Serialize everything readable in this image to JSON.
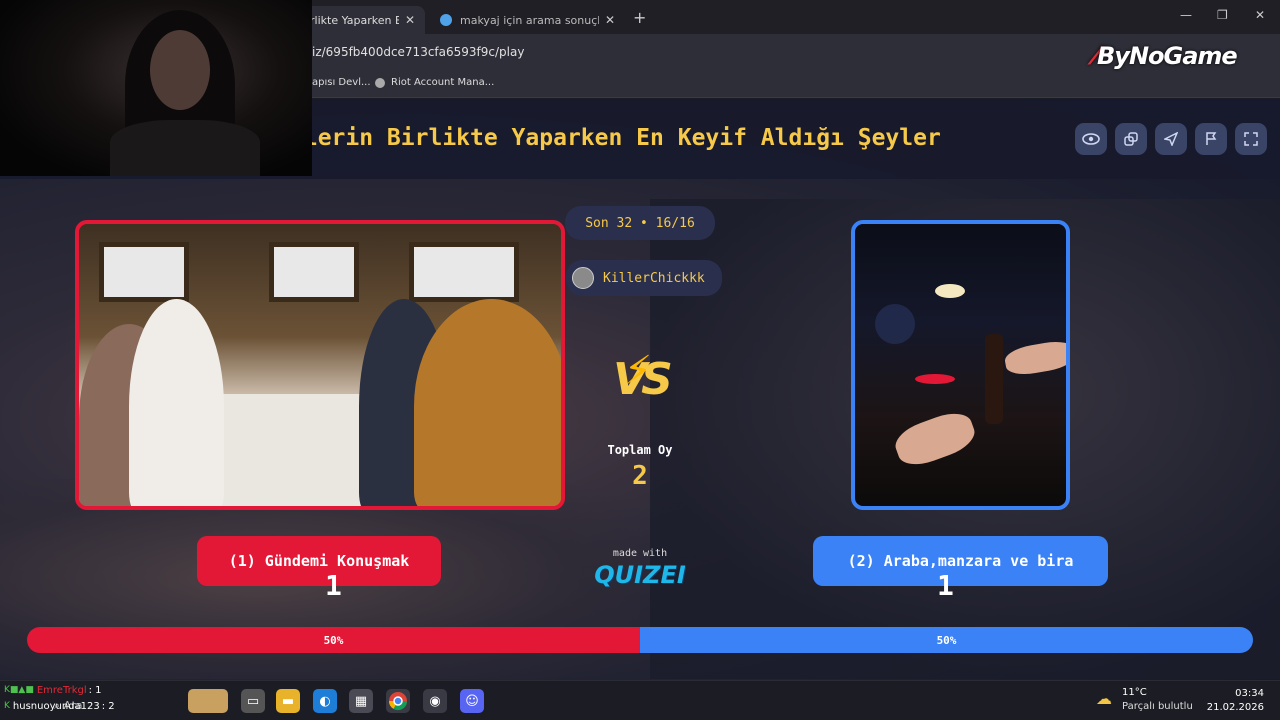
{
  "browser": {
    "tabs": [
      {
        "title": "rlikte Yaparken En K",
        "active": true
      },
      {
        "title": "makyaj için arama sonuçları - O",
        "active": false
      }
    ],
    "url": "iz/695fb400dce713cfa6593f9c/play",
    "bookmarks": [
      "apısı Devl...",
      "Riot Account Mana..."
    ]
  },
  "watermark": "ByNoGame",
  "quiz": {
    "title": "klerin Birlikte Yaparken En Keyif Aldığı Şeyler",
    "round": "Son 32 • 16/16",
    "player": "KillerChickkk",
    "vs": "VS",
    "total_label": "Toplam Oy",
    "total_votes": "2",
    "left_choice": "(1) Gündemi Konuşmak",
    "right_choice": "(2) Araba,manzara ve bira",
    "left_votes": "1",
    "right_votes": "1",
    "made_with": "made with",
    "brand": "QUIZEI",
    "left_percent_label": "50%",
    "right_percent_label": "50%",
    "left_share": 0.5,
    "colors": {
      "left": "#e31837",
      "right": "#3b82f6",
      "accent": "#f7c948"
    }
  },
  "header_buttons": [
    "eye-icon",
    "share-icon",
    "send-icon",
    "flag-icon",
    "fullscreen-icon"
  ],
  "chat": [
    {
      "user": "EmreTrkgl",
      "msg": ": 1"
    },
    {
      "user": "husnuoyunda123",
      "msg": ": 2"
    }
  ],
  "taskbar": {
    "search_placeholder": "Ara",
    "temp": "11°C",
    "condition": "Parçalı bulutlu",
    "time": "03:34",
    "date": "21.02.2026"
  }
}
